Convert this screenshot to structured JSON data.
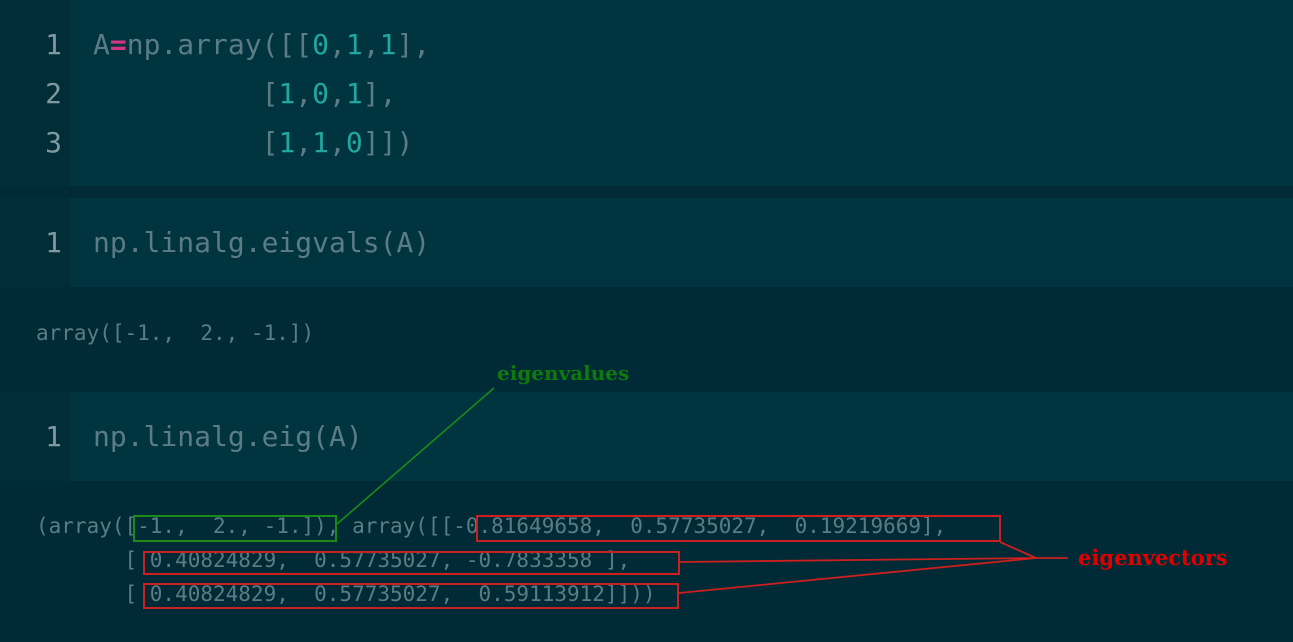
{
  "cell1": {
    "line_numbers": [
      "1",
      "2",
      "3"
    ],
    "lines": [
      {
        "a": "A",
        "op": "=",
        "b": "np.array([[",
        "n1": "0",
        "c1": ",",
        "n2": "1",
        "c2": ",",
        "n3": "1",
        "tail": "],"
      },
      {
        "a": "          [",
        "n1": "1",
        "c1": ",",
        "n2": "0",
        "c2": ",",
        "n3": "1",
        "tail": "],"
      },
      {
        "a": "          [",
        "n1": "1",
        "c1": ",",
        "n2": "1",
        "c2": ",",
        "n3": "0",
        "tail": "]])"
      }
    ]
  },
  "cell2": {
    "line_number": "1",
    "code": "np.linalg.eigvals(A)",
    "output": "array([-1.,  2., -1.])"
  },
  "cell3": {
    "line_number": "1",
    "code": "np.linalg.eig(A)",
    "output_lines": [
      "(array([-1.,  2., -1.]), array([[-0.81649658,  0.57735027,  0.19219669],",
      "       [ 0.40824829,  0.57735027, -0.7833358 ],",
      "       [ 0.40824829,  0.57735027,  0.59113912]]))"
    ]
  },
  "annotations": {
    "eigenvalues": "eigenvalues",
    "eigenvectors": "eigenvectors",
    "eigenvalues_color": "#0e7a0e",
    "eigenvectors_color": "#e00000"
  },
  "colors": {
    "background": "#002b36",
    "cell_input": "#00343e",
    "number": "#21a7a1",
    "operator": "#d33682",
    "text": "#5c7c85"
  }
}
